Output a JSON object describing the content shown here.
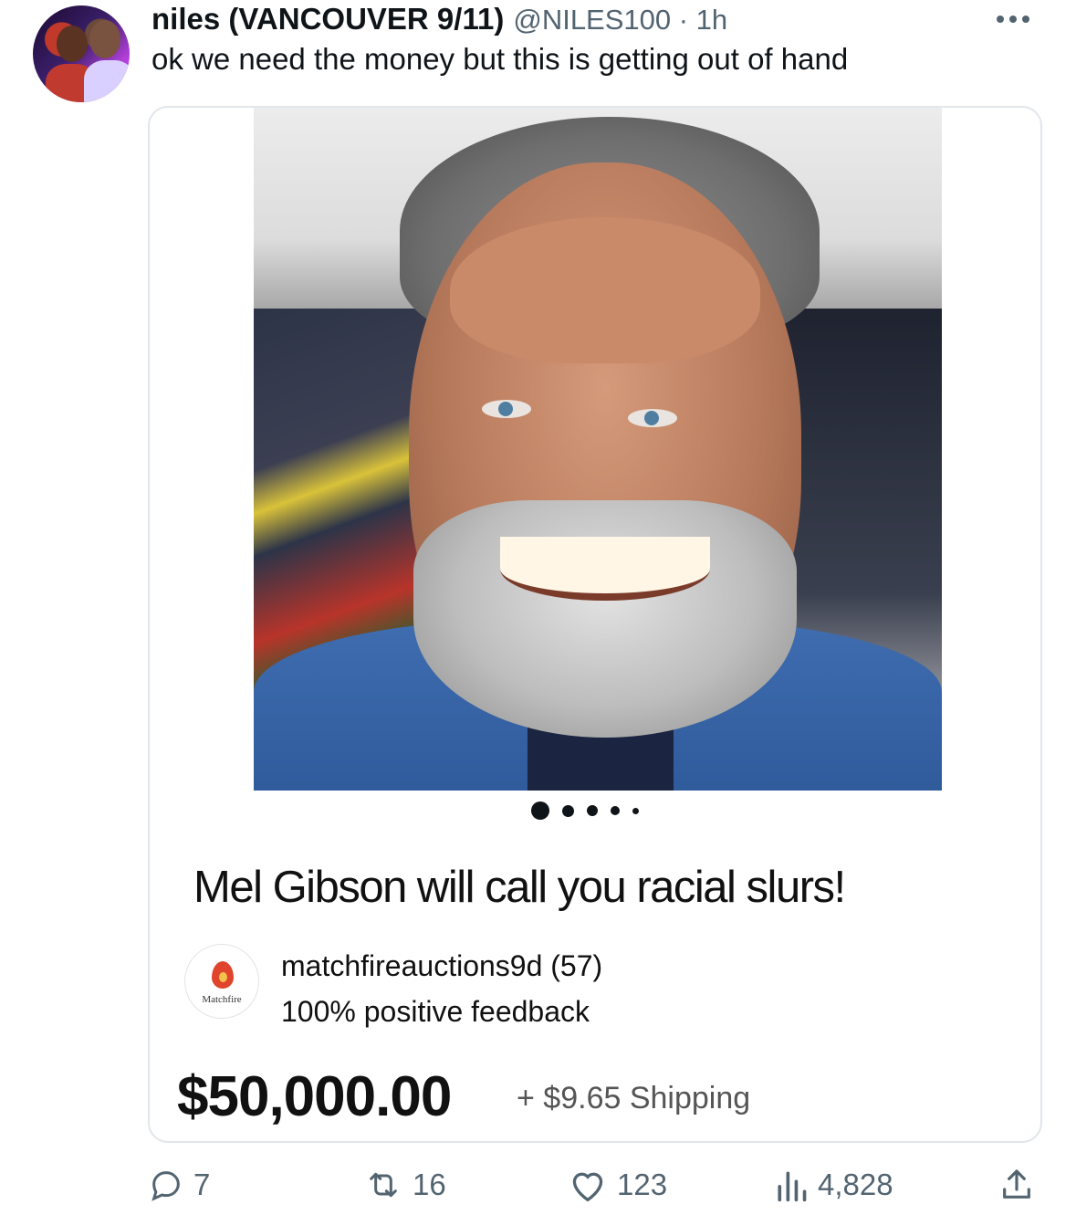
{
  "tweet": {
    "author_name": "niles (VANCOUVER 9/11)",
    "handle_time": "@NILES100 · 1h",
    "text": "ok we need the money but this is getting out of hand"
  },
  "listing": {
    "title": "Mel Gibson will call you racial slurs!",
    "seller_logo_text": "Matchfire",
    "seller_name": "matchfireauctions9d (57)",
    "seller_feedback": "100% positive feedback",
    "price": "$50,000.00",
    "shipping": "+ $9.65 Shipping",
    "image_carousel_count": 5,
    "image_carousel_active": 1
  },
  "metrics": {
    "replies": "7",
    "reposts": "16",
    "likes": "123",
    "views": "4,828"
  },
  "colors": {
    "text": "#0f1419",
    "muted": "#536471",
    "border": "#e1e6ea"
  },
  "icons": [
    "more-icon",
    "reply-icon",
    "repost-icon",
    "like-icon",
    "views-icon",
    "share-icon"
  ]
}
